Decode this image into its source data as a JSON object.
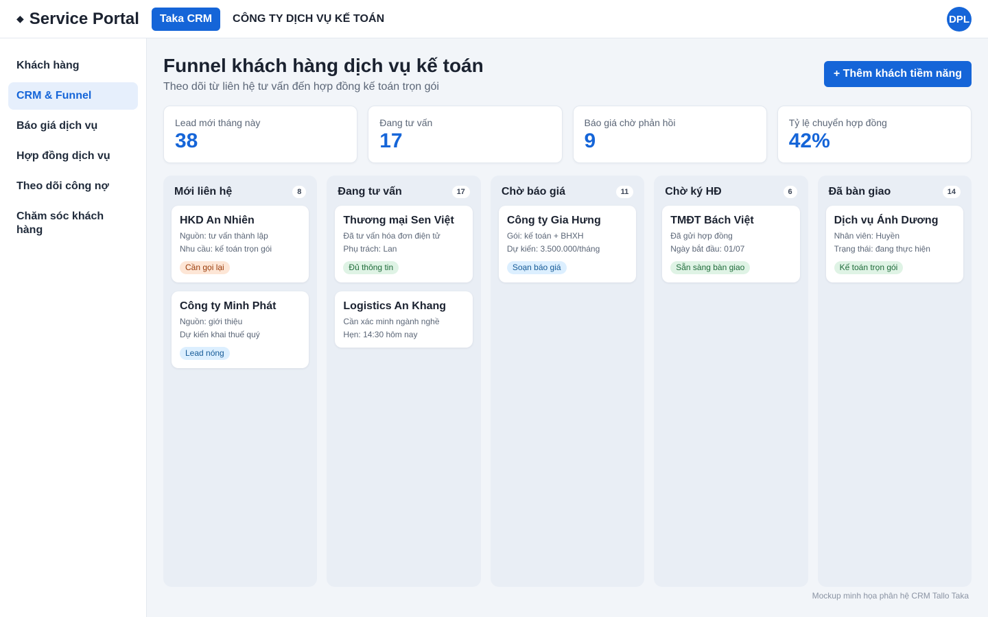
{
  "header": {
    "brand": "Service Portal",
    "brand_icon": "diamond-icon",
    "app_badge": "Taka CRM",
    "company": "CÔNG TY DỊCH VỤ KẾ TOÁN",
    "avatar": "DPL",
    "accent_color": "#1565d8"
  },
  "sidebar": {
    "items": [
      {
        "label": "Khách hàng",
        "active": false
      },
      {
        "label": "CRM & Funnel",
        "active": true
      },
      {
        "label": "Báo giá dịch vụ",
        "active": false
      },
      {
        "label": "Hợp đồng dịch vụ",
        "active": false
      },
      {
        "label": "Theo dõi công nợ",
        "active": false
      },
      {
        "label": "Chăm sóc khách hàng",
        "active": false
      }
    ]
  },
  "page": {
    "title": "Funnel khách hàng dịch vụ kế toán",
    "subtitle": "Theo dõi từ liên hệ tư vấn đến hợp đồng kế toán trọn gói",
    "primary_action": "+ Thêm khách tiềm năng"
  },
  "stats": [
    {
      "label": "Lead mới tháng này",
      "value": "38"
    },
    {
      "label": "Đang tư vấn",
      "value": "17"
    },
    {
      "label": "Báo giá chờ phản hồi",
      "value": "9"
    },
    {
      "label": "Tỷ lệ chuyển hợp đồng",
      "value": "42%"
    }
  ],
  "columns": [
    {
      "title": "Mới liên hệ",
      "count": "8",
      "cards": [
        {
          "title": "HKD An Nhiên",
          "lines": [
            "Nguồn: tư vấn thành lập",
            "Nhu cầu: kế toán trọn gói"
          ],
          "tag": "Cần gọi lại",
          "tag_color": "orange"
        },
        {
          "title": "Công ty Minh Phát",
          "lines": [
            "Nguồn: giới thiệu",
            "Dự kiến khai thuế quý"
          ],
          "tag": "Lead nóng",
          "tag_color": "blue"
        }
      ]
    },
    {
      "title": "Đang tư vấn",
      "count": "17",
      "cards": [
        {
          "title": "Thương mại Sen Việt",
          "lines": [
            "Đã tư vấn hóa đơn điện tử",
            "Phụ trách: Lan"
          ],
          "tag": "Đủ thông tin",
          "tag_color": "green"
        },
        {
          "title": "Logistics An Khang",
          "lines": [
            "Cần xác minh ngành nghề",
            "Hẹn: 14:30 hôm nay"
          ],
          "tag": null,
          "tag_color": null
        }
      ]
    },
    {
      "title": "Chờ báo giá",
      "count": "11",
      "cards": [
        {
          "title": "Công ty Gia Hưng",
          "lines": [
            "Gói: kế toán + BHXH",
            "Dự kiến: 3.500.000/tháng"
          ],
          "tag": "Soạn báo giá",
          "tag_color": "blue"
        }
      ]
    },
    {
      "title": "Chờ ký HĐ",
      "count": "6",
      "cards": [
        {
          "title": "TMĐT Bách Việt",
          "lines": [
            "Đã gửi hợp đồng",
            "Ngày bắt đầu: 01/07"
          ],
          "tag": "Sẵn sàng bàn giao",
          "tag_color": "green"
        }
      ]
    },
    {
      "title": "Đã bàn giao",
      "count": "14",
      "cards": [
        {
          "title": "Dịch vụ Ánh Dương",
          "lines": [
            "Nhân viên: Huyền",
            "Trạng thái: đang thực hiện"
          ],
          "tag": "Kế toán trọn gói",
          "tag_color": "green"
        }
      ]
    }
  ],
  "footer_note": "Mockup minh họa phân hệ CRM Tallo Taka"
}
